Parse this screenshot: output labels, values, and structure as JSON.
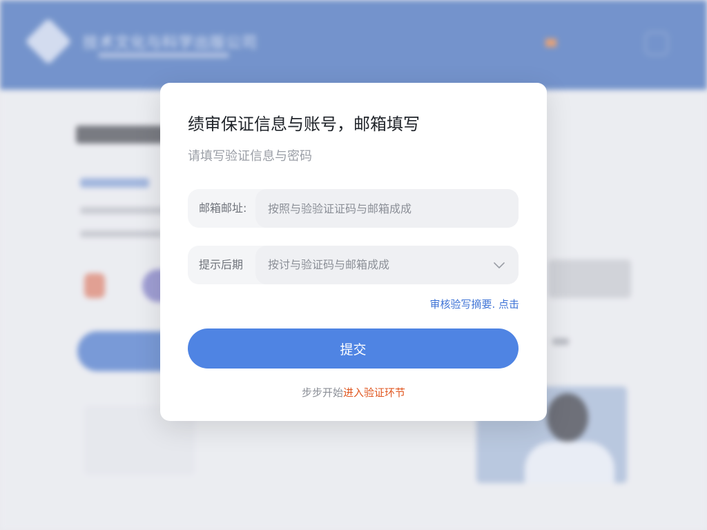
{
  "background": {
    "org_name": "技术文化与科学出版公司"
  },
  "modal": {
    "title": "绩审保证信息与账号，邮箱填写",
    "subtitle": "请填写验证信息与密码",
    "email": {
      "label": "邮箱邮址:",
      "value": "",
      "placeholder": "按照与验验证证码与邮箱成成"
    },
    "period": {
      "label": "提示后期",
      "selected": "按讨与验证码与邮箱成成"
    },
    "help_link": "审核验写摘要. 点击",
    "submit_label": "提交",
    "footer_prefix": "步步开始",
    "footer_link": "进入验证环节"
  },
  "colors": {
    "header_blue": "#3565b8",
    "primary_button": "#4f84e3",
    "link_blue": "#3e73d6",
    "link_orange": "#e0561f"
  }
}
